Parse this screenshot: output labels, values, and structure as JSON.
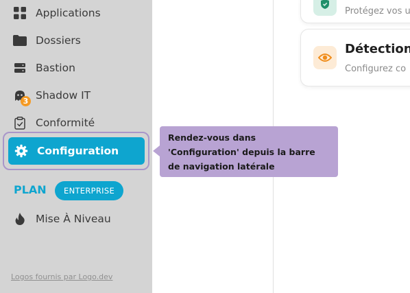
{
  "sidebar": {
    "items": [
      {
        "label": "Applications",
        "icon": "grid-icon"
      },
      {
        "label": "Dossiers",
        "icon": "folder-icon"
      },
      {
        "label": "Bastion",
        "icon": "server-icon"
      },
      {
        "label": "Shadow IT",
        "icon": "ghost-icon",
        "badge": "3"
      },
      {
        "label": "Conformité",
        "icon": "clipboard-check-icon"
      }
    ],
    "active_item": {
      "label": "Configuration",
      "icon": "gear-icon"
    },
    "plan_label": "PLAN",
    "plan_badge": "ENTERPRISE",
    "upgrade": {
      "label": "Mise À Niveau",
      "icon": "flame-icon"
    },
    "footer_link": "Logos fournis par Logo.dev"
  },
  "tooltip": {
    "text": "Rendez-vous dans 'Configuration' depuis la barre de navigation latérale"
  },
  "cards": [
    {
      "title": "",
      "description": "Protégez vos u",
      "icon": "shield-check-icon"
    },
    {
      "title": "Détection",
      "description": "Configurez co",
      "icon": "eye-icon"
    }
  ],
  "colors": {
    "accent": "#0ea5cf",
    "sidebar_bg": "#d4d4d4",
    "tooltip_bg": "#b8a3d3",
    "badge": "#f59a23",
    "eye_icon_bg": "#fdebd6",
    "eye_icon": "#f08c1a",
    "shield_icon_bg": "#d6efe6",
    "shield_icon": "#1f8f6a"
  }
}
